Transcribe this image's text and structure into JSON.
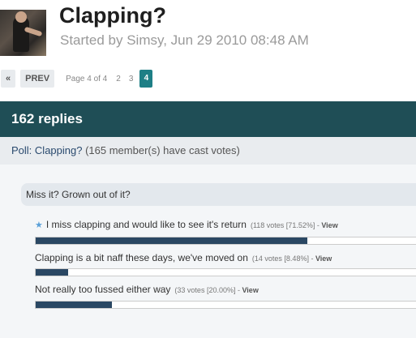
{
  "topic": {
    "title": "Clapping?",
    "subtitle": "Started by Simsy, Jun 29 2010 08:48 AM"
  },
  "pager": {
    "first": "«",
    "prev": "PREV",
    "info": "Page 4 of 4",
    "pages": [
      "2",
      "3"
    ],
    "current": "4"
  },
  "replies": "162 replies",
  "poll": {
    "label": "Poll:",
    "question_title": "Clapping?",
    "members": "(165 member(s) have cast votes)",
    "question": "Miss it? Grown out of it?",
    "choices": [
      {
        "text": "I miss clapping and would like to see it's return",
        "votes": "(118 votes [71.52%]",
        "view": "View",
        "percent": 71.52,
        "starred": true
      },
      {
        "text": "Clapping is a bit naff these days, we've moved on",
        "votes": "(14 votes [8.48%]",
        "view": "View",
        "percent": 8.48,
        "starred": false
      },
      {
        "text": "Not really too fussed either way",
        "votes": "(33 votes [20.00%]",
        "view": "View",
        "percent": 20.0,
        "starred": false
      }
    ]
  },
  "colors": {
    "header": "#1f4e56",
    "accent": "#1e7f86",
    "bar": "#2a4763"
  }
}
